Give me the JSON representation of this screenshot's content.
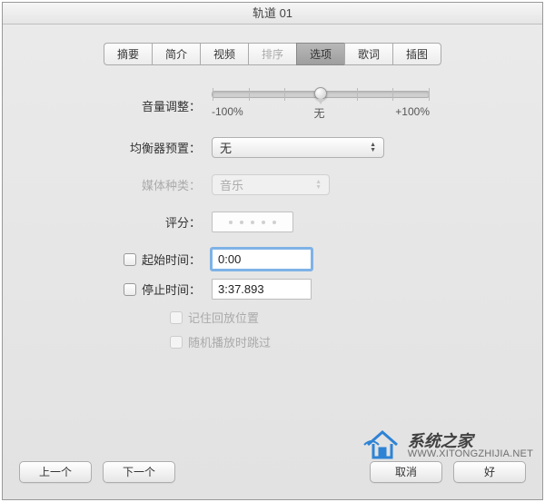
{
  "window": {
    "title": "轨道 01"
  },
  "tabs": [
    {
      "label": "摘要"
    },
    {
      "label": "简介"
    },
    {
      "label": "视频"
    },
    {
      "label": "排序"
    },
    {
      "label": "选项"
    },
    {
      "label": "歌词"
    },
    {
      "label": "插图"
    }
  ],
  "volume": {
    "label": "音量调整：",
    "min_label": "-100%",
    "mid_label": "无",
    "max_label": "+100%"
  },
  "eq": {
    "label": "均衡器预置：",
    "value": "无"
  },
  "media_kind": {
    "label": "媒体种类：",
    "value": "音乐"
  },
  "rating": {
    "label": "评分："
  },
  "start_time": {
    "label": "起始时间：",
    "value": "0:00"
  },
  "stop_time": {
    "label": "停止时间：",
    "value": "3:37.893"
  },
  "remember_position": {
    "label": "记住回放位置"
  },
  "skip_shuffle": {
    "label": "随机播放时跳过"
  },
  "buttons": {
    "prev": "上一个",
    "next": "下一个",
    "cancel": "取消",
    "ok": "好"
  },
  "watermark": {
    "zh": "系统之家",
    "en": "WWW.XITONGZHIJIA.NET"
  }
}
